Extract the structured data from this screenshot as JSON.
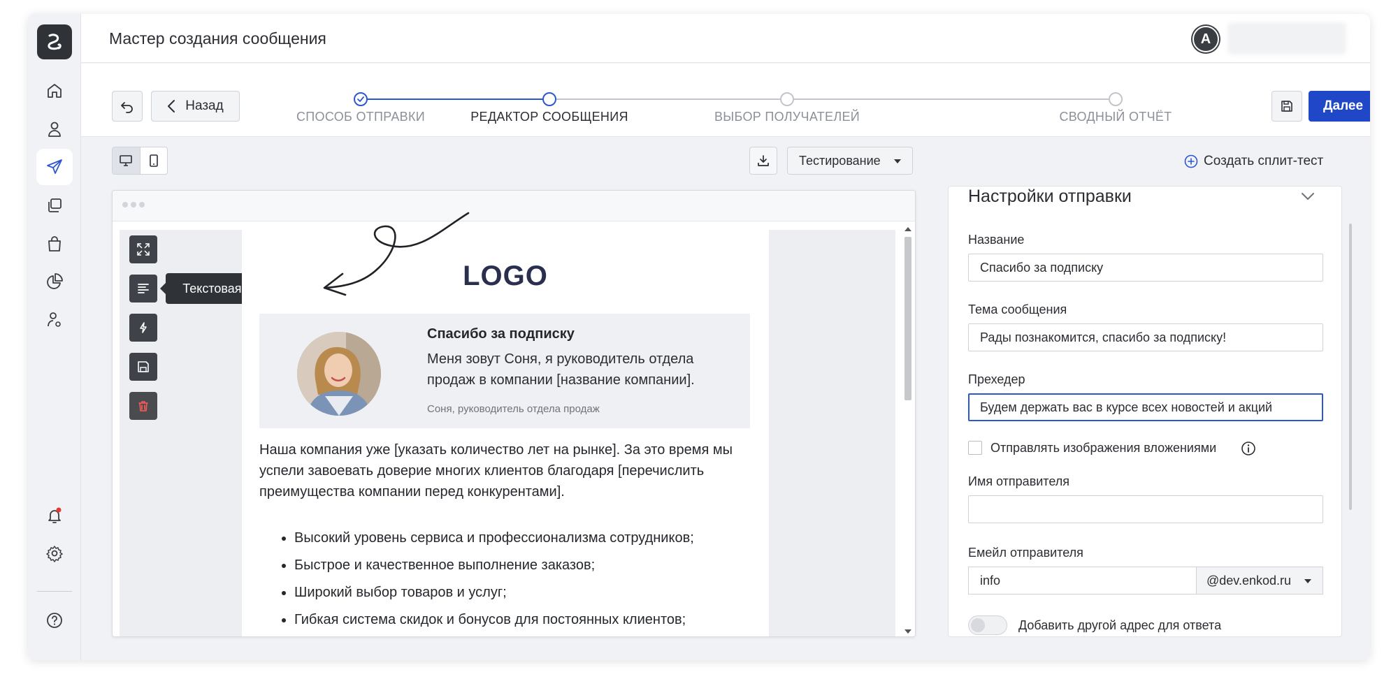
{
  "header": {
    "title": "Мастер создания сообщения",
    "avatar_letter": "A"
  },
  "sidebar": {
    "items": [
      {
        "icon": "home-icon"
      },
      {
        "icon": "user-icon"
      },
      {
        "icon": "send-icon",
        "active": true
      },
      {
        "icon": "templates-icon"
      },
      {
        "icon": "shopping-bag-icon"
      },
      {
        "icon": "pie-chart-icon"
      },
      {
        "icon": "user-settings-icon"
      },
      {
        "icon": "bell-icon",
        "notification": true
      },
      {
        "icon": "gear-icon"
      },
      {
        "icon": "help-icon"
      }
    ]
  },
  "wizard": {
    "back_label": "Назад",
    "next_label": "Далее",
    "steps": [
      {
        "label": "СПОСОБ ОТПРАВКИ",
        "state": "done"
      },
      {
        "label": "РЕДАКТОР СООБЩЕНИЯ",
        "state": "current"
      },
      {
        "label": "ВЫБОР ПОЛУЧАТЕЛЕЙ",
        "state": "todo"
      },
      {
        "label": "СВОДНЫЙ ОТЧЁТ",
        "state": "todo"
      }
    ]
  },
  "toolbar": {
    "testing_label": "Тестирование",
    "split_test_label": "Создать сплит-тест"
  },
  "editor": {
    "tooltip": "Текстовая версия",
    "tools": [
      "expand-icon",
      "text-version-icon",
      "amp-icon",
      "save-icon",
      "trash-icon"
    ],
    "email": {
      "logo": "LOGO",
      "card_title": "Спасибо за подписку",
      "card_text": "Меня зовут Соня, я руководитель отдела продаж в компании [название компании].",
      "card_signature": "Соня, руководитель отдела продаж",
      "paragraph": "Наша компания уже [указать количество лет на рынке]. За это время мы успели завоевать доверие многих клиентов благодаря [перечислить преимущества компании перед конкурентами].",
      "list": [
        "Высокий уровень сервиса и профессионализма сотрудников;",
        "Быстрое и качественное выполнение заказов;",
        "Широкий выбор товаров и услуг;",
        "Гибкая система скидок и бонусов для постоянных клиентов;"
      ]
    }
  },
  "settings": {
    "title": "Настройки отправки",
    "name_label": "Название",
    "name_value": "Спасибо за подписку",
    "subject_label": "Тема сообщения",
    "subject_value": "Рады познакомится, спасибо за подписку!",
    "preheader_label": "Прехедер",
    "preheader_value": "Будем держать вас в курсе всех новостей и акций",
    "attach_images_label": "Отправлять изображения вложениями",
    "sender_name_label": "Имя отправителя",
    "sender_name_value": "",
    "sender_email_label": "Емейл отправителя",
    "sender_email_value": "info",
    "sender_domain": "@dev.enkod.ru",
    "reply_to_label": "Добавить другой адрес для ответа"
  },
  "colors": {
    "accent": "#1f47c8",
    "sidebar_bg": "#f1f2f6",
    "dark": "#2f3338"
  }
}
